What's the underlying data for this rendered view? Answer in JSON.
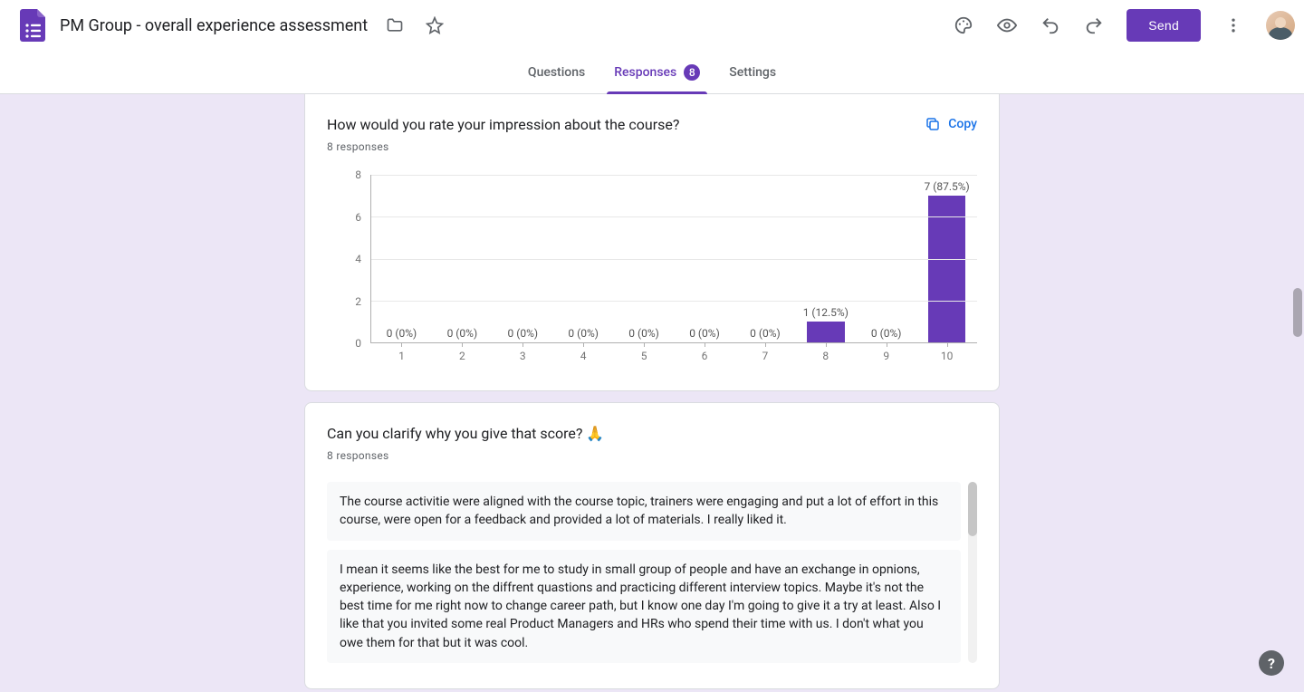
{
  "header": {
    "doc_title": "PM Group - overall experience assessment",
    "send_label": "Send"
  },
  "tabs": {
    "questions": "Questions",
    "responses": "Responses",
    "settings": "Settings",
    "responses_count": "8",
    "active": "responses"
  },
  "card1": {
    "title": "How would you rate your impression about the course?",
    "subtitle": "8 responses",
    "copy_label": "Copy"
  },
  "card2": {
    "title": "Can you clarify why you give that score? 🙏",
    "subtitle": "8 responses",
    "responses": [
      "The course activitie were aligned with the course topic, trainers were engaging and put a lot of effort in this course, were open for a feedback and provided a lot of materials. I really liked it.",
      "I mean it seems like the best for me to study in small group of people and have an exchange in opnions, experience, working on the diffrent quastions and practicing different interview topics. Maybe it's not the best time for me right now to change career path, but I know one day I'm going to give it a try at least. Also I like that you invited some real Product Managers and HRs who spend their time with us. I don't what you owe them for that but it was cool."
    ]
  },
  "chart_data": {
    "type": "bar",
    "title": "How would you rate your impression about the course?",
    "categories": [
      "1",
      "2",
      "3",
      "4",
      "5",
      "6",
      "7",
      "8",
      "9",
      "10"
    ],
    "values": [
      0,
      0,
      0,
      0,
      0,
      0,
      0,
      1,
      0,
      7
    ],
    "value_labels": [
      "0 (0%)",
      "0 (0%)",
      "0 (0%)",
      "0 (0%)",
      "0 (0%)",
      "0 (0%)",
      "0 (0%)",
      "1 (12.5%)",
      "0 (0%)",
      "7 (87.5%)"
    ],
    "y_ticks": [
      0,
      2,
      4,
      6,
      8
    ],
    "ylim": [
      0,
      8
    ],
    "ylabel": "",
    "xlabel": ""
  },
  "colors": {
    "accent": "#673ab7",
    "link": "#1a73e8",
    "canvas_bg": "#ece6f6"
  }
}
